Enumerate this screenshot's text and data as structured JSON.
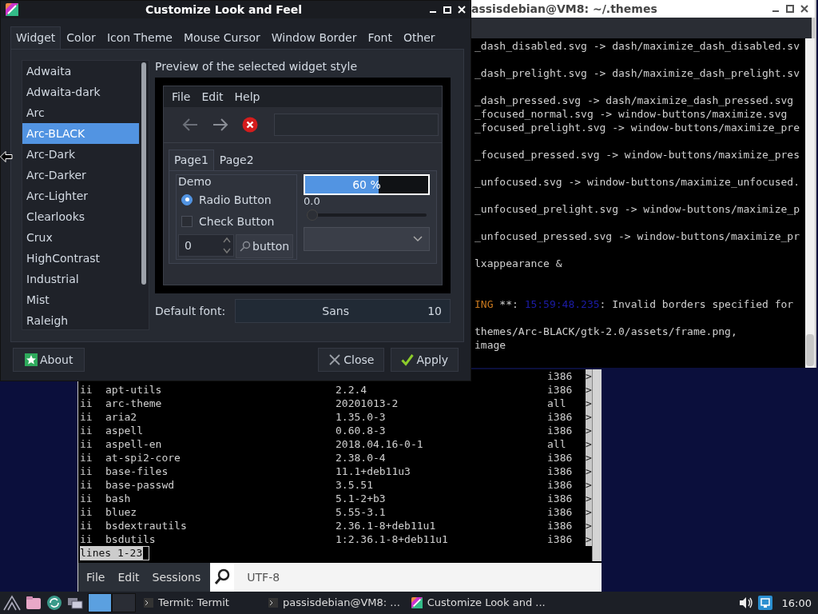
{
  "dialog": {
    "title": "Customize Look and Feel",
    "tabs": [
      {
        "label": "Widget",
        "selected": true
      },
      {
        "label": "Color",
        "selected": false
      },
      {
        "label": "Icon Theme",
        "selected": false
      },
      {
        "label": "Mouse Cursor",
        "selected": false
      },
      {
        "label": "Window Border",
        "selected": false
      },
      {
        "label": "Font",
        "selected": false
      },
      {
        "label": "Other",
        "selected": false
      }
    ],
    "themes": [
      {
        "label": "Adwaita",
        "selected": false
      },
      {
        "label": "Adwaita-dark",
        "selected": false
      },
      {
        "label": "Arc",
        "selected": false
      },
      {
        "label": "Arc-BLACK",
        "selected": true
      },
      {
        "label": "Arc-Dark",
        "selected": false
      },
      {
        "label": "Arc-Darker",
        "selected": false
      },
      {
        "label": "Arc-Lighter",
        "selected": false
      },
      {
        "label": "Clearlooks",
        "selected": false
      },
      {
        "label": "Crux",
        "selected": false
      },
      {
        "label": "HighContrast",
        "selected": false
      },
      {
        "label": "Industrial",
        "selected": false
      },
      {
        "label": "Mist",
        "selected": false
      },
      {
        "label": "Raleigh",
        "selected": false
      }
    ],
    "preview_label": "Preview of the selected widget style",
    "preview": {
      "menu": [
        "File",
        "Edit",
        "Help"
      ],
      "tabs": [
        {
          "label": "Page1",
          "selected": true
        },
        {
          "label": "Page2",
          "selected": false
        }
      ],
      "frame_label": "Demo",
      "radio": {
        "label": "Radio Button",
        "checked": true
      },
      "check": {
        "label": "Check Button",
        "checked": false
      },
      "spin_value": "0",
      "button_label": "button",
      "progress": {
        "level": 0.6,
        "text": "60 %"
      },
      "scale": {
        "reading": "0.0",
        "level": 0
      }
    },
    "default_font": {
      "label": "Default font:",
      "family": "Sans",
      "size": "10"
    },
    "buttons": [
      {
        "label": "About",
        "kind": "about"
      },
      {
        "label": "Close",
        "kind": "close"
      },
      {
        "label": "Apply",
        "kind": "apply"
      }
    ]
  },
  "themes_terminal": {
    "title": "assisdebian@VM8: ~/.themes",
    "lines": [
      {
        "segments": [
          {
            "text": "_dash_disabled.svg -> dash/maximize_dash_disabled.sv",
            "color": "#d0d0d0"
          }
        ]
      },
      {
        "kind": "blank"
      },
      {
        "segments": [
          {
            "text": "_dash_prelight.svg -> dash/maximize_dash_prelight.sv",
            "color": "#d0d0d0"
          }
        ]
      },
      {
        "kind": "blank"
      },
      {
        "segments": [
          {
            "text": "_dash_pressed.svg -> dash/maximize_dash_pressed.svg",
            "color": "#d0d0d0"
          }
        ]
      },
      {
        "segments": [
          {
            "text": "_focused_normal.svg -> window-buttons/maximize.svg",
            "color": "#d0d0d0"
          }
        ]
      },
      {
        "segments": [
          {
            "text": "_focused_prelight.svg -> window-buttons/maximize_pre",
            "color": "#d0d0d0"
          }
        ]
      },
      {
        "kind": "blank"
      },
      {
        "segments": [
          {
            "text": "_focused_pressed.svg -> window-buttons/maximize_pres",
            "color": "#d0d0d0"
          }
        ]
      },
      {
        "kind": "blank"
      },
      {
        "segments": [
          {
            "text": "_unfocused.svg -> window-buttons/maximize_unfocused.",
            "color": "#d0d0d0"
          }
        ]
      },
      {
        "kind": "blank"
      },
      {
        "segments": [
          {
            "text": "_unfocused_prelight.svg -> window-buttons/maximize_p",
            "color": "#d0d0d0"
          }
        ]
      },
      {
        "kind": "blank"
      },
      {
        "segments": [
          {
            "text": "_unfocused_pressed.svg -> window-buttons/maximize_pr",
            "color": "#d0d0d0"
          }
        ]
      },
      {
        "kind": "blank"
      },
      {
        "segments": [
          {
            "text": "lxappearance &",
            "color": "#d0d0d0"
          }
        ]
      },
      {
        "kind": "blank"
      },
      {
        "kind": "blank"
      },
      {
        "segments": [
          {
            "text": "ING",
            "color": "#c8781e"
          },
          {
            "text": " **: "
          },
          {
            "text": "15:59:48.235",
            "color": "#1c1ca8"
          },
          {
            "text": ": Invalid borders specified for"
          }
        ]
      },
      {
        "kind": "blank"
      },
      {
        "segments": [
          {
            "text": "themes/Arc-BLACK/gtk-2.0/assets/frame.png,",
            "color": "#d0d0d0"
          }
        ]
      },
      {
        "segments": [
          {
            "text": "image",
            "color": "#d0d0d0"
          }
        ]
      }
    ]
  },
  "package_terminal": {
    "rows": [
      {
        "arch": "i386",
        "more": ">"
      },
      {
        "status": "ii",
        "name": "apt-utils",
        "version": "2.2.4",
        "arch": "i386",
        "more": ">"
      },
      {
        "status": "ii",
        "name": "arc-theme",
        "version": "20201013-2",
        "arch": "all",
        "more": ">"
      },
      {
        "status": "ii",
        "name": "aria2",
        "version": "1.35.0-3",
        "arch": "i386",
        "more": ">"
      },
      {
        "status": "ii",
        "name": "aspell",
        "version": "0.60.8-3",
        "arch": "i386",
        "more": ">"
      },
      {
        "status": "ii",
        "name": "aspell-en",
        "version": "2018.04.16-0-1",
        "arch": "all",
        "more": ">"
      },
      {
        "status": "ii",
        "name": "at-spi2-core",
        "version": "2.38.0-4",
        "arch": "i386",
        "more": ">"
      },
      {
        "status": "ii",
        "name": "base-files",
        "version": "11.1+deb11u3",
        "arch": "i386",
        "more": ">"
      },
      {
        "status": "ii",
        "name": "base-passwd",
        "version": "3.5.51",
        "arch": "i386",
        "more": ">"
      },
      {
        "status": "ii",
        "name": "bash",
        "version": "5.1-2+b3",
        "arch": "i386",
        "more": ">"
      },
      {
        "status": "ii",
        "name": "bluez",
        "version": "5.55-3.1",
        "arch": "i386",
        "more": ">"
      },
      {
        "status": "ii",
        "name": "bsdextrautils",
        "version": "2.36.1-8+deb11u1",
        "arch": "i386",
        "more": ">"
      },
      {
        "status": "ii",
        "name": "bsdutils",
        "version": "1:2.36.1-8+deb11u1",
        "arch": "i386",
        "more": ">"
      }
    ],
    "status_line": "lines 1-23",
    "menu": [
      "File",
      "Edit",
      "Sessions"
    ],
    "encoding": "UTF-8"
  },
  "taskbar": {
    "tasks": [
      {
        "label": "Termit: Termit",
        "kind": "terminal"
      },
      {
        "label": "passisdebian@VM8: ...",
        "kind": "terminal"
      },
      {
        "label": "Customize Look and ...",
        "kind": "appearance"
      }
    ],
    "clock": "16:00"
  }
}
